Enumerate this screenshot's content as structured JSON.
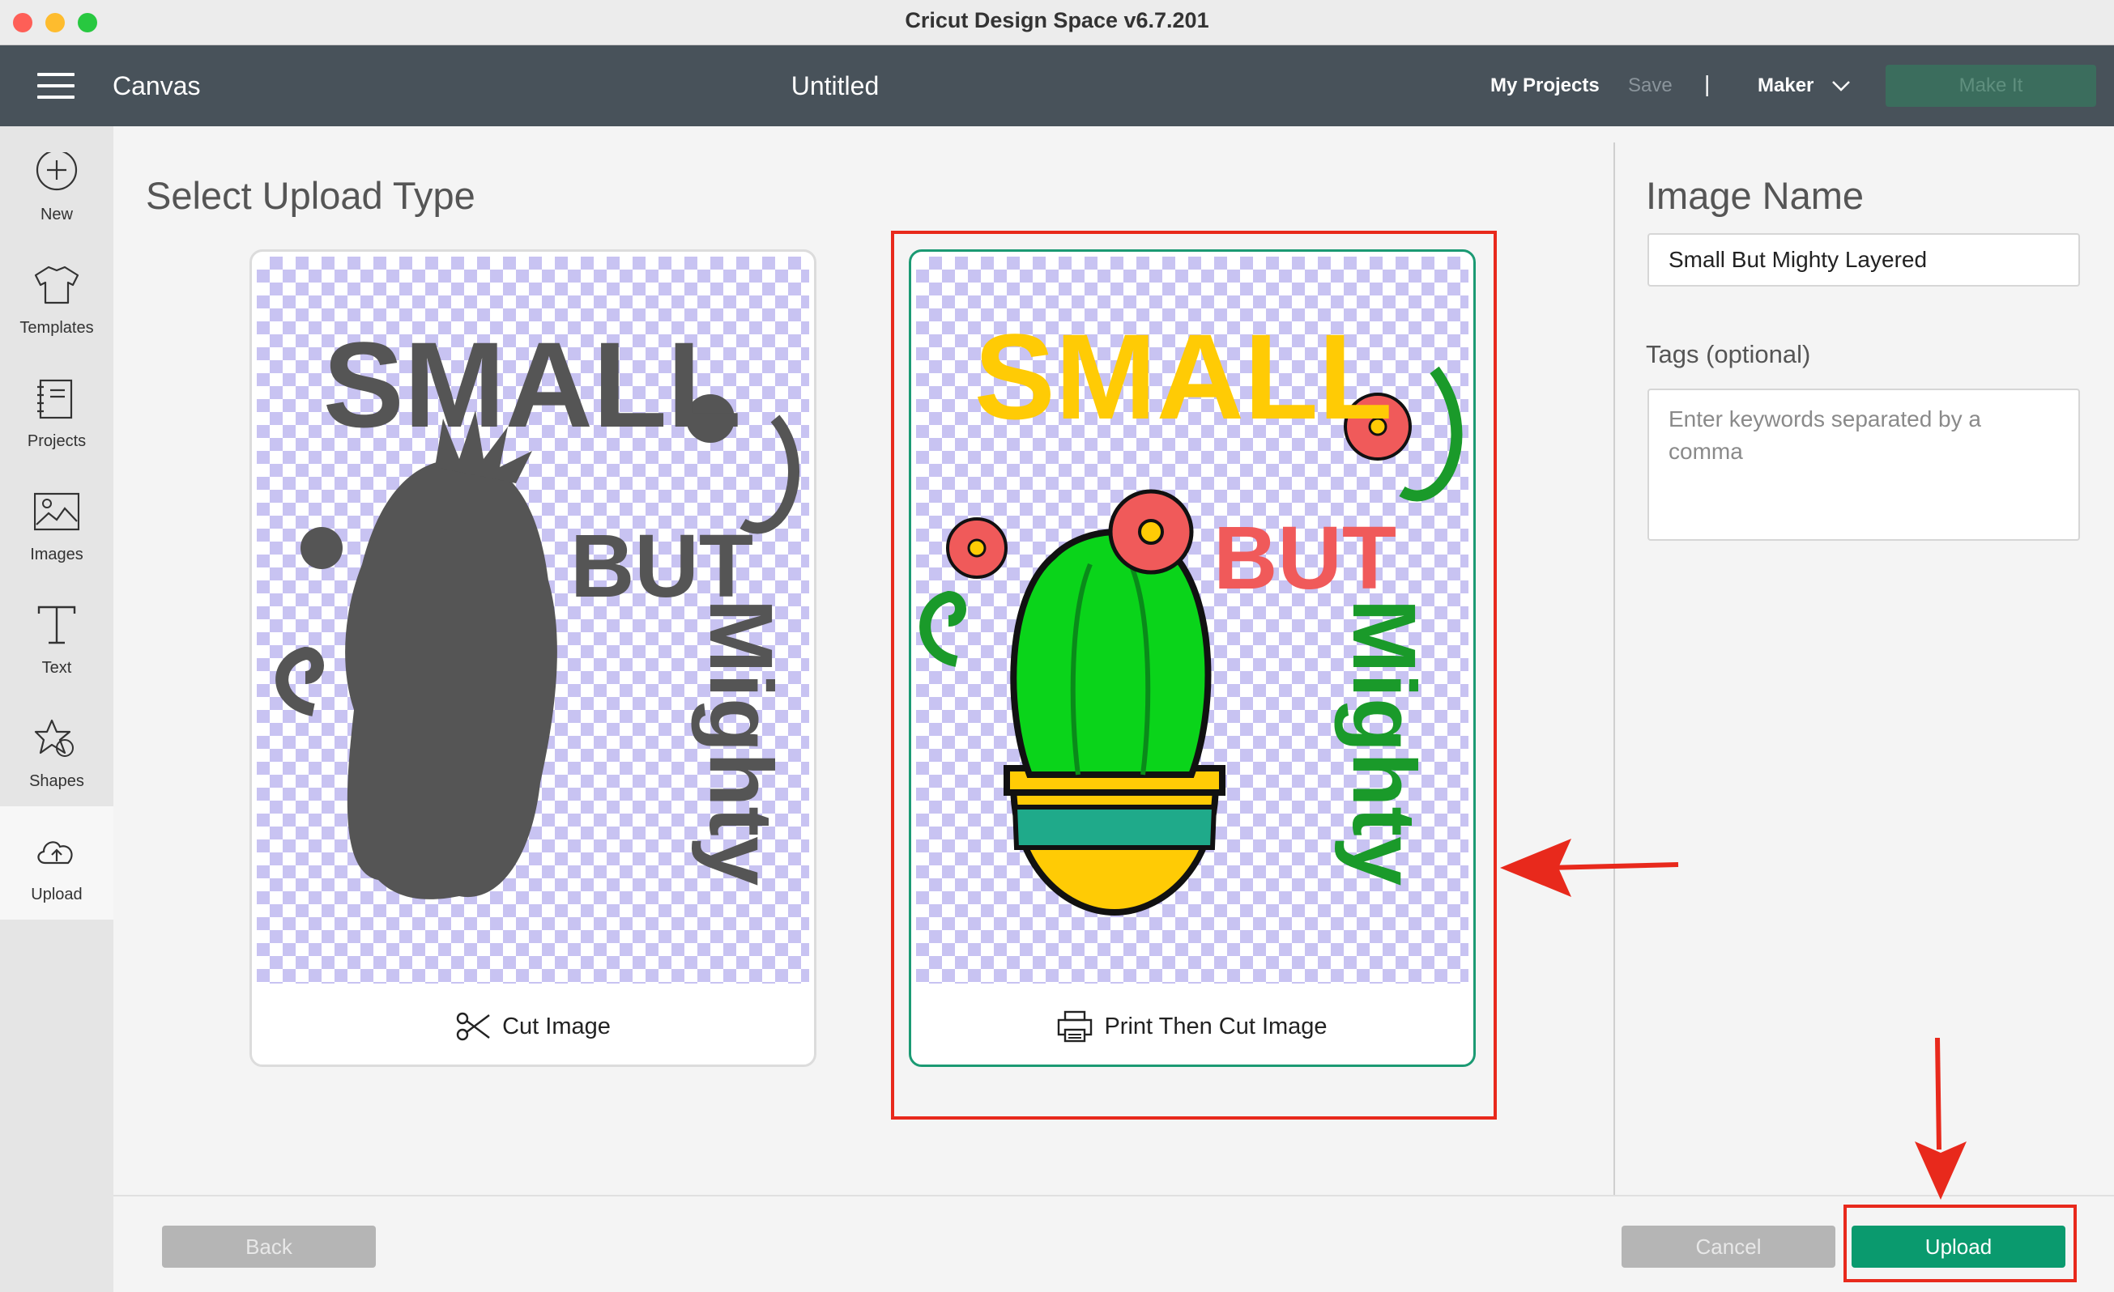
{
  "window": {
    "title": "Cricut Design Space  v6.7.201"
  },
  "topnav": {
    "section": "Canvas",
    "document_title": "Untitled",
    "my_projects": "My Projects",
    "save": "Save",
    "separator": "|",
    "machine": "Maker",
    "make_it": "Make It"
  },
  "sidebar": {
    "items": [
      {
        "label": "New",
        "icon": "plus-circle-icon"
      },
      {
        "label": "Templates",
        "icon": "tshirt-icon"
      },
      {
        "label": "Projects",
        "icon": "notebook-icon"
      },
      {
        "label": "Images",
        "icon": "image-icon"
      },
      {
        "label": "Text",
        "icon": "text-t-icon"
      },
      {
        "label": "Shapes",
        "icon": "shapes-icon"
      },
      {
        "label": "Upload",
        "icon": "cloud-upload-icon",
        "active": true
      }
    ]
  },
  "main": {
    "title": "Select Upload Type",
    "options": [
      {
        "label": "Cut Image",
        "icon": "scissors-icon",
        "selected": false
      },
      {
        "label": "Print Then Cut Image",
        "icon": "printer-icon",
        "selected": true
      }
    ],
    "artwork_text": {
      "line1": "SMALL",
      "line2": "BUT",
      "line3": "Mighty"
    }
  },
  "right_panel": {
    "image_name_label": "Image Name",
    "image_name_value": "Small But Mighty Layered",
    "tags_label": "Tags (optional)",
    "tags_placeholder": "Enter keywords separated by a comma"
  },
  "footer": {
    "back": "Back",
    "cancel": "Cancel",
    "upload": "Upload"
  },
  "colors": {
    "nav_bg": "#48525a",
    "accent_green": "#0a9a6e",
    "annotation_red": "#e8291c",
    "checker_lavender": "#c8c3f2"
  }
}
